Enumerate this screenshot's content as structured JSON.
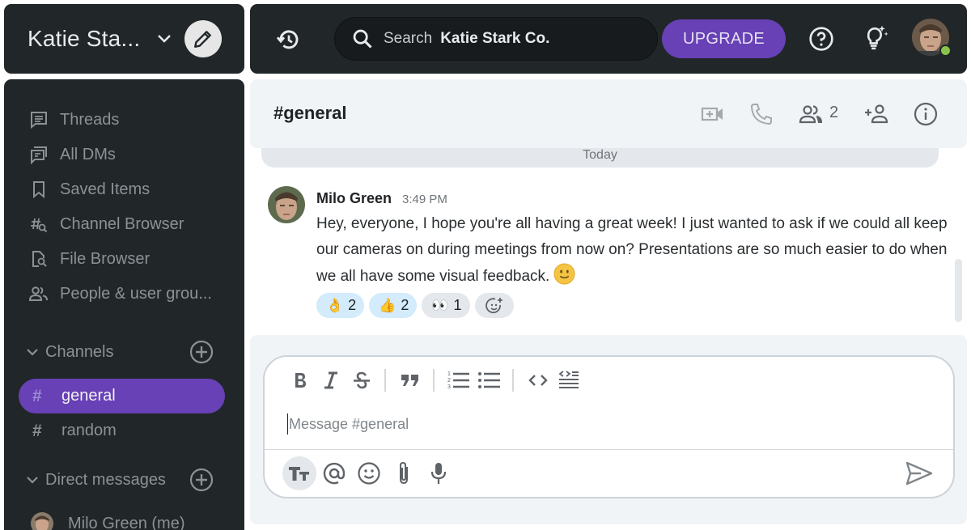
{
  "workspace": {
    "name": "Katie Sta...",
    "edit_label": "Compose"
  },
  "topbar": {
    "search_label": "Search",
    "search_scope": "Katie Stark Co.",
    "upgrade_label": "UPGRADE",
    "user_status": "online"
  },
  "sidebar": {
    "nav_items": [
      {
        "label": "Threads",
        "icon": "threads-icon"
      },
      {
        "label": "All DMs",
        "icon": "all-dms-icon"
      },
      {
        "label": "Saved Items",
        "icon": "bookmark-icon"
      },
      {
        "label": "Channel Browser",
        "icon": "channel-browser-icon"
      },
      {
        "label": "File Browser",
        "icon": "file-browser-icon"
      },
      {
        "label": "People & user grou...",
        "icon": "people-icon"
      }
    ],
    "channels_label": "Channels",
    "channels": [
      {
        "name": "general",
        "active": true
      },
      {
        "name": "random",
        "active": false
      }
    ],
    "dms_label": "Direct messages",
    "dms": [
      {
        "name": "Milo Green (me)"
      }
    ]
  },
  "channel": {
    "title": "#general",
    "member_count": "2"
  },
  "date_divider": "Today",
  "messages": [
    {
      "author": "Milo Green",
      "time": "3:49 PM",
      "body": "Hey, everyone, I hope you're all having a great week! I just wanted to ask if we could all keep our cameras on during meetings from now on? Presentations are so much easier to do when we all have some visual feedback.",
      "reactions": [
        {
          "emoji": "👌",
          "count": "2",
          "mine": true
        },
        {
          "emoji": "👍",
          "count": "2",
          "mine": true
        },
        {
          "emoji": "👀",
          "count": "1",
          "mine": false
        }
      ]
    }
  ],
  "composer": {
    "placeholder": "Message #general",
    "value": ""
  },
  "colors": {
    "accent": "#6741b5",
    "sidebar_bg": "#212629",
    "presence": "#8bc34a",
    "reaction_mine": "#d3ebfb"
  }
}
